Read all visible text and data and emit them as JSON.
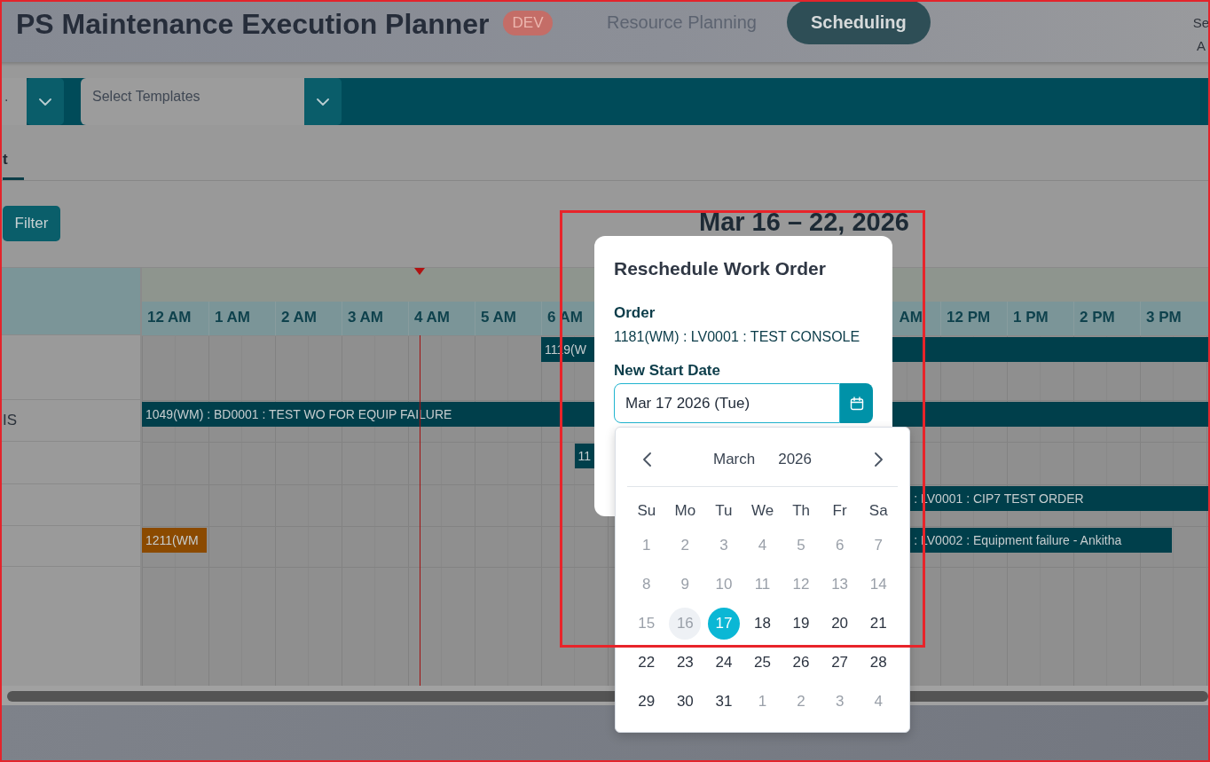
{
  "header": {
    "title": "PS Maintenance Execution Planner",
    "env_badge": "DEV",
    "nav": [
      {
        "label": "Resource Planning",
        "selected": false
      },
      {
        "label": "Scheduling",
        "selected": true
      }
    ],
    "user_lines": [
      "Se",
      "A"
    ]
  },
  "toolbar": {
    "selects": [
      {
        "value": "."
      },
      {
        "placeholder": "Select Templates"
      }
    ]
  },
  "tabs": [
    {
      "label": "t",
      "selected": true
    }
  ],
  "filter_button": "Filter",
  "date_range": "Mar 16 – 22, 2026",
  "gantt": {
    "hours_left": [
      "12 AM",
      "1 AM",
      "2 AM",
      "3 AM",
      "4 AM",
      "5 AM",
      "6 AM"
    ],
    "hours_right": [
      "AM",
      "12 PM",
      "1 PM",
      "2 PM",
      "3 PM"
    ],
    "rows": [
      {
        "bars": [
          {
            "label": "1119(W",
            "color": "#003f4b"
          }
        ]
      },
      {
        "resource": "IS",
        "bars": [
          {
            "label": "1049(WM) : BD0001 : TEST WO FOR EQUIP FAILURE",
            "color": "#003f4b"
          }
        ]
      },
      {
        "bars": [
          {
            "label": "11",
            "color": "#003f4b"
          }
        ]
      },
      {
        "bars": [
          {
            "label": ": LV0001 : CIP7 TEST ORDER",
            "color": "#003f4b"
          }
        ]
      },
      {
        "bars": [
          {
            "label": "1211(WM",
            "color": "#8b4a00"
          },
          {
            "label": ": LV0002 : Equipment failure - Ankitha",
            "color": "#003f4b"
          }
        ]
      }
    ]
  },
  "dialog": {
    "title": "Reschedule Work Order",
    "order_label": "Order",
    "order_value": "1181(WM) : LV0001 : TEST CONSOLE",
    "date_label": "New Start Date",
    "date_value": "Mar 17 2026 (Tue)",
    "date_picker": {
      "month": "March",
      "year": "2026",
      "weekdays": [
        "Su",
        "Mo",
        "Tu",
        "We",
        "Th",
        "Fr",
        "Sa"
      ],
      "days": [
        {
          "label": "1",
          "muted": true,
          "today": false,
          "selected": false
        },
        {
          "label": "2",
          "muted": true,
          "today": false,
          "selected": false
        },
        {
          "label": "3",
          "muted": true,
          "today": false,
          "selected": false
        },
        {
          "label": "4",
          "muted": true,
          "today": false,
          "selected": false
        },
        {
          "label": "5",
          "muted": true,
          "today": false,
          "selected": false
        },
        {
          "label": "6",
          "muted": true,
          "today": false,
          "selected": false
        },
        {
          "label": "7",
          "muted": true,
          "today": false,
          "selected": false
        },
        {
          "label": "8",
          "muted": true,
          "today": false,
          "selected": false
        },
        {
          "label": "9",
          "muted": true,
          "today": false,
          "selected": false
        },
        {
          "label": "10",
          "muted": true,
          "today": false,
          "selected": false
        },
        {
          "label": "11",
          "muted": true,
          "today": false,
          "selected": false
        },
        {
          "label": "12",
          "muted": true,
          "today": false,
          "selected": false
        },
        {
          "label": "13",
          "muted": true,
          "today": false,
          "selected": false
        },
        {
          "label": "14",
          "muted": true,
          "today": false,
          "selected": false
        },
        {
          "label": "15",
          "muted": true,
          "today": false,
          "selected": false
        },
        {
          "label": "16",
          "muted": true,
          "today": true,
          "selected": false
        },
        {
          "label": "17",
          "muted": false,
          "today": false,
          "selected": true
        },
        {
          "label": "18",
          "muted": false,
          "today": false,
          "selected": false
        },
        {
          "label": "19",
          "muted": false,
          "today": false,
          "selected": false
        },
        {
          "label": "20",
          "muted": false,
          "today": false,
          "selected": false
        },
        {
          "label": "21",
          "muted": false,
          "today": false,
          "selected": false
        },
        {
          "label": "22",
          "muted": false,
          "today": false,
          "selected": false
        },
        {
          "label": "23",
          "muted": false,
          "today": false,
          "selected": false
        },
        {
          "label": "24",
          "muted": false,
          "today": false,
          "selected": false
        },
        {
          "label": "25",
          "muted": false,
          "today": false,
          "selected": false
        },
        {
          "label": "26",
          "muted": false,
          "today": false,
          "selected": false
        },
        {
          "label": "27",
          "muted": false,
          "today": false,
          "selected": false
        },
        {
          "label": "28",
          "muted": false,
          "today": false,
          "selected": false
        },
        {
          "label": "29",
          "muted": false,
          "today": false,
          "selected": false
        },
        {
          "label": "30",
          "muted": false,
          "today": false,
          "selected": false
        },
        {
          "label": "31",
          "muted": false,
          "today": false,
          "selected": false
        },
        {
          "label": "1",
          "muted": true,
          "today": false,
          "selected": false
        },
        {
          "label": "2",
          "muted": true,
          "today": false,
          "selected": false
        },
        {
          "label": "3",
          "muted": true,
          "today": false,
          "selected": false
        },
        {
          "label": "4",
          "muted": true,
          "today": false,
          "selected": false
        }
      ]
    }
  }
}
